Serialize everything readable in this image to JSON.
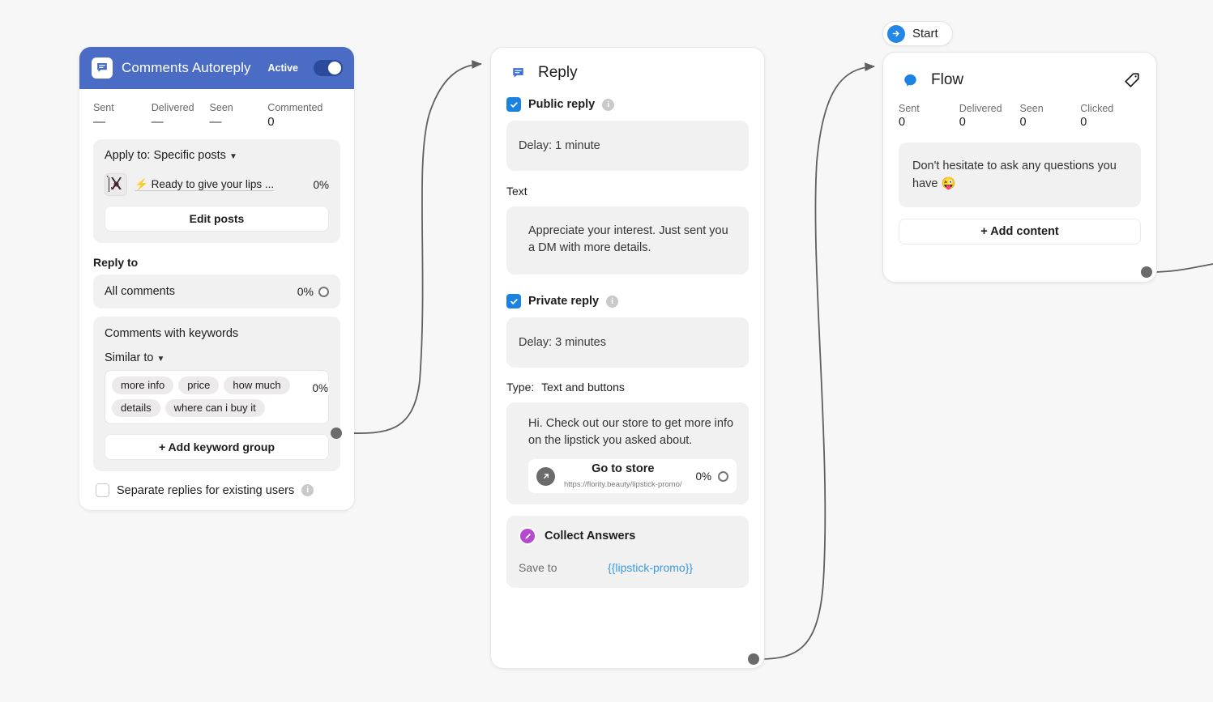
{
  "canvas": {
    "background": "#f7f7f7",
    "edge_color": "#5f5f5f"
  },
  "start_pill": {
    "label": "Start",
    "icon": "arrow-right-circle-icon"
  },
  "comments_node": {
    "header": {
      "title": "Comments Autoreply",
      "icon": "comment-bubble-icon",
      "status_label": "Active",
      "toggle_on": true,
      "accent": "#4a6cc4"
    },
    "stats": [
      {
        "label": "Sent",
        "value": "—"
      },
      {
        "label": "Delivered",
        "value": "—"
      },
      {
        "label": "Seen",
        "value": "—"
      },
      {
        "label": "Commented",
        "value": "0"
      }
    ],
    "apply_to": {
      "label": "Apply to: Specific posts",
      "caret": "▼"
    },
    "post": {
      "title": "Ready to give your lips ...",
      "bolt": "⚡",
      "percent": "0%"
    },
    "edit_posts_button": "Edit posts",
    "reply_to_label": "Reply to",
    "all_comments": {
      "label": "All comments",
      "percent": "0%"
    },
    "keywords_panel": {
      "title": "Comments with keywords",
      "match_mode": "Similar to",
      "caret": "▼",
      "percent": "0%",
      "chips": [
        "more info",
        "price",
        "how much",
        "details",
        "where can i buy it"
      ],
      "add_group_button": "+ Add keyword group"
    },
    "separate_replies": {
      "label": "Separate replies for existing users",
      "checked": false,
      "info": "i"
    }
  },
  "reply_node": {
    "title": "Reply",
    "icon": "comment-bubble-icon",
    "public_reply": {
      "label": "Public reply",
      "checked": true,
      "info": "i",
      "delay": "Delay: 1 minute"
    },
    "text_label": "Text",
    "public_text": "Appreciate your interest. Just sent you a DM with more details.",
    "private_reply": {
      "label": "Private reply",
      "checked": true,
      "info": "i",
      "delay": "Delay: 3 minutes"
    },
    "type": {
      "label": "Type:",
      "value": "Text and buttons"
    },
    "private_text": "Hi. Check out our store to get more info on the lipstick you asked about.",
    "button": {
      "title": "Go to store",
      "url": "https://flority.beauty/lipstick-promo/",
      "percent": "0%",
      "icon": "external-link-icon"
    },
    "collect_answers": {
      "title": "Collect Answers",
      "icon": "pencil-circle-icon",
      "save_to_label": "Save to",
      "variable": "{{lipstick-promo}}",
      "accent": "#b44ad0"
    }
  },
  "flow_node": {
    "title": "Flow",
    "icon": "messenger-bubble-icon",
    "tag_icon": "tag-icon",
    "stats": [
      {
        "label": "Sent",
        "value": "0"
      },
      {
        "label": "Delivered",
        "value": "0"
      },
      {
        "label": "Seen",
        "value": "0"
      },
      {
        "label": "Clicked",
        "value": "0"
      }
    ],
    "message": "Don't hesitate to ask any questions you have 😜",
    "add_content_button": "+ Add content"
  }
}
